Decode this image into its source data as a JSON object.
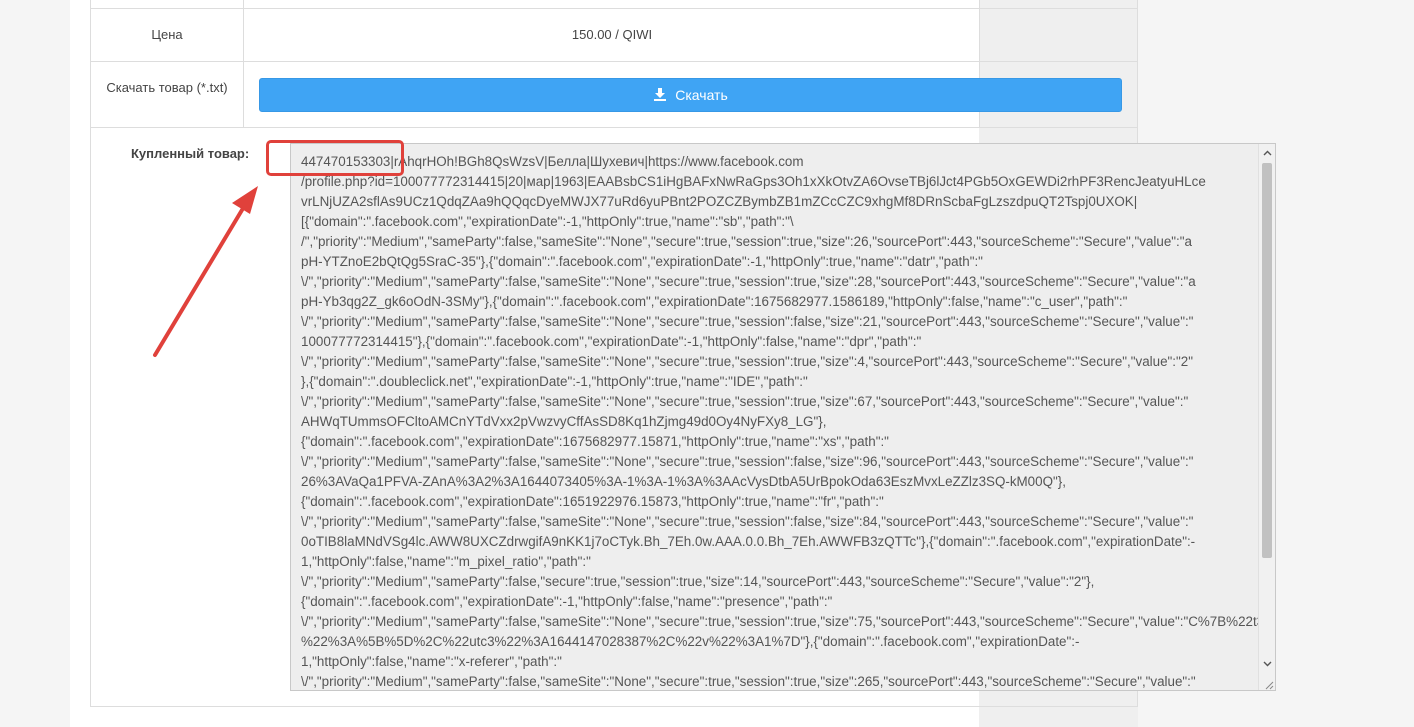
{
  "details": {
    "price_label": "Цена",
    "price_value": "150.00 / QIWI",
    "download_label": "Скачать товар (*.txt)",
    "download_button_label": "Скачать",
    "download_icon": "download-icon",
    "purchased_label": "Купленный товар:"
  },
  "purchased_content": {
    "lines": [
      "447470153303|rAhqrHOh!BGh8QsWzsV|Белла|Шухевич|https://www.facebook.com",
      "/profile.php?id=100077772314415|20|мар|1963|EAABsbCS1iHgBAFxNwRaGps3Oh1xXkOtvZA6OvseTBj6lJct4PGb5OxGEWDi2rhPF3RencJeatyuHLce",
      "vrLNjUZA2sflAs9UCz1QdqZAa9hQQqcDyeMWJX77uRd6yuPBnt2POZCZBymbZB1mZCcCZC9xhgMf8DRnScbaFgLzszdpuQT2Tspj0UXOK|",
      "[{\"domain\":\".facebook.com\",\"expirationDate\":-1,\"httpOnly\":true,\"name\":\"sb\",\"path\":\"\\",
      "/\",\"priority\":\"Medium\",\"sameParty\":false,\"sameSite\":\"None\",\"secure\":true,\"session\":true,\"size\":26,\"sourcePort\":443,\"sourceScheme\":\"Secure\",\"value\":\"a",
      "pH-YTZnoE2bQtQg5SraC-35\"},{\"domain\":\".facebook.com\",\"expirationDate\":-1,\"httpOnly\":true,\"name\":\"datr\",\"path\":\"",
      "\\/\",\"priority\":\"Medium\",\"sameParty\":false,\"sameSite\":\"None\",\"secure\":true,\"session\":true,\"size\":28,\"sourcePort\":443,\"sourceScheme\":\"Secure\",\"value\":\"a",
      "pH-Yb3qg2Z_gk6oOdN-3SMy\"},{\"domain\":\".facebook.com\",\"expirationDate\":1675682977.1586189,\"httpOnly\":false,\"name\":\"c_user\",\"path\":\"",
      "\\/\",\"priority\":\"Medium\",\"sameParty\":false,\"sameSite\":\"None\",\"secure\":true,\"session\":false,\"size\":21,\"sourcePort\":443,\"sourceScheme\":\"Secure\",\"value\":\"",
      "100077772314415\"},{\"domain\":\".facebook.com\",\"expirationDate\":-1,\"httpOnly\":false,\"name\":\"dpr\",\"path\":\"",
      "\\/\",\"priority\":\"Medium\",\"sameParty\":false,\"sameSite\":\"None\",\"secure\":true,\"session\":true,\"size\":4,\"sourcePort\":443,\"sourceScheme\":\"Secure\",\"value\":\"2\"",
      "},{\"domain\":\".doubleclick.net\",\"expirationDate\":-1,\"httpOnly\":true,\"name\":\"IDE\",\"path\":\"",
      "\\/\",\"priority\":\"Medium\",\"sameParty\":false,\"sameSite\":\"None\",\"secure\":true,\"session\":true,\"size\":67,\"sourcePort\":443,\"sourceScheme\":\"Secure\",\"value\":\"",
      "AHWqTUmmsOFCltoAMCnYTdVxx2pVwzvyCffAsSD8Kq1hZjmg49d0Oy4NyFXy8_LG\"},",
      "{\"domain\":\".facebook.com\",\"expirationDate\":1675682977.15871,\"httpOnly\":true,\"name\":\"xs\",\"path\":\"",
      "\\/\",\"priority\":\"Medium\",\"sameParty\":false,\"sameSite\":\"None\",\"secure\":true,\"session\":false,\"size\":96,\"sourcePort\":443,\"sourceScheme\":\"Secure\",\"value\":\"",
      "26%3AVaQa1PFVA-ZAnA%3A2%3A1644073405%3A-1%3A-1%3A%3AAcVysDtbA5UrBpokOda63EszMvxLeZZlz3SQ-kM00Q\"},",
      "{\"domain\":\".facebook.com\",\"expirationDate\":1651922976.15873,\"httpOnly\":true,\"name\":\"fr\",\"path\":\"",
      "\\/\",\"priority\":\"Medium\",\"sameParty\":false,\"sameSite\":\"None\",\"secure\":true,\"session\":false,\"size\":84,\"sourcePort\":443,\"sourceScheme\":\"Secure\",\"value\":\"",
      "0oTIB8laMNdVSg4lc.AWW8UXCZdrwgifA9nKK1j7oCTyk.Bh_7Eh.0w.AAA.0.0.Bh_7Eh.AWWFB3zQTTc\"},{\"domain\":\".facebook.com\",\"expirationDate\":-",
      "1,\"httpOnly\":false,\"name\":\"m_pixel_ratio\",\"path\":\"",
      "\\/\",\"priority\":\"Medium\",\"sameParty\":false,\"secure\":true,\"session\":true,\"size\":14,\"sourcePort\":443,\"sourceScheme\":\"Secure\",\"value\":\"2\"},",
      "{\"domain\":\".facebook.com\",\"expirationDate\":-1,\"httpOnly\":false,\"name\":\"presence\",\"path\":\"",
      "\\/\",\"priority\":\"Medium\",\"sameParty\":false,\"sameSite\":\"None\",\"secure\":true,\"session\":true,\"size\":75,\"sourcePort\":443,\"sourceScheme\":\"Secure\",\"value\":\"C%7B%22t3",
      "%22%3A%5B%5D%2C%22utc3%22%3A1644147028387%2C%22v%22%3A1%7D\"},{\"domain\":\".facebook.com\",\"expirationDate\":-",
      "1,\"httpOnly\":false,\"name\":\"x-referer\",\"path\":\"",
      "\\/\",\"priority\":\"Medium\",\"sameParty\":false,\"sameSite\":\"None\",\"secure\":true,\"session\":true,\"size\":265,\"sourcePort\":443,\"sourceScheme\":\"Secure\",\"value\":\""
    ]
  },
  "annotation": {
    "highlight_color": "#e0413b",
    "shapes": [
      "highlight-box",
      "pointer-arrow"
    ]
  },
  "colors": {
    "button_bg": "#3fa4f4",
    "textarea_bg": "#eeeeee",
    "border": "#dddddd"
  }
}
